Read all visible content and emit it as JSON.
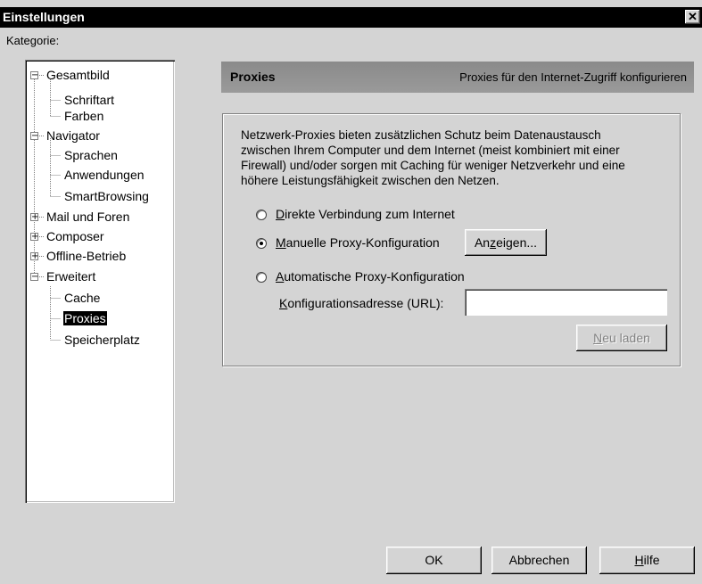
{
  "window": {
    "title": "Einstellungen",
    "close_glyph": "✕"
  },
  "category_label": "Kategorie:",
  "tree": [
    {
      "label": "Gesamtbild",
      "level": 0,
      "expander": "−"
    },
    {
      "label": "Schriftart",
      "level": 1
    },
    {
      "label": "Farben",
      "level": 1
    },
    {
      "label": "Navigator",
      "level": 0,
      "expander": "−"
    },
    {
      "label": "Sprachen",
      "level": 1
    },
    {
      "label": "Anwendungen",
      "level": 1
    },
    {
      "label": "SmartBrowsing",
      "level": 1
    },
    {
      "label": "Mail und Foren",
      "level": 0,
      "expander": "+"
    },
    {
      "label": "Composer",
      "level": 0,
      "expander": "+"
    },
    {
      "label": "Offline-Betrieb",
      "level": 0,
      "expander": "+"
    },
    {
      "label": "Erweitert",
      "level": 0,
      "expander": "−"
    },
    {
      "label": "Cache",
      "level": 1
    },
    {
      "label": "Proxies",
      "level": 1,
      "selected": true
    },
    {
      "label": "Speicherplatz",
      "level": 1
    }
  ],
  "header": {
    "title": "Proxies",
    "description": "Proxies für den Internet-Zugriff konfigurieren"
  },
  "description_lines": [
    "Netzwerk-Proxies bieten zusätzlichen Schutz beim Datenaustausch",
    "zwischen Ihrem Computer und dem Internet (meist kombiniert mit einer",
    "Firewall) und/oder sorgen mit Caching für weniger Netzverkehr und eine",
    "höhere Leistungsfähigkeit zwischen den Netzen."
  ],
  "options": {
    "direct": {
      "mnemonic": "D",
      "rest": "irekte Verbindung zum Internet",
      "checked": false
    },
    "manual": {
      "mnemonic": "M",
      "rest": "anuelle Proxy-Konfiguration",
      "checked": true
    },
    "auto": {
      "mnemonic": "A",
      "rest": "utomatische Proxy-Konfiguration",
      "checked": false
    }
  },
  "show_button": {
    "pre": "An",
    "mnemonic": "z",
    "post": "eigen..."
  },
  "url_field": {
    "mnemonic": "K",
    "rest": "onfigurationsadresse (URL):",
    "value": ""
  },
  "reload_button": {
    "mnemonic": "N",
    "rest": "eu laden",
    "disabled": true
  },
  "footer": {
    "ok": "OK",
    "cancel": "Abbrechen",
    "help_mnemonic": "H",
    "help_rest": "ilfe"
  }
}
